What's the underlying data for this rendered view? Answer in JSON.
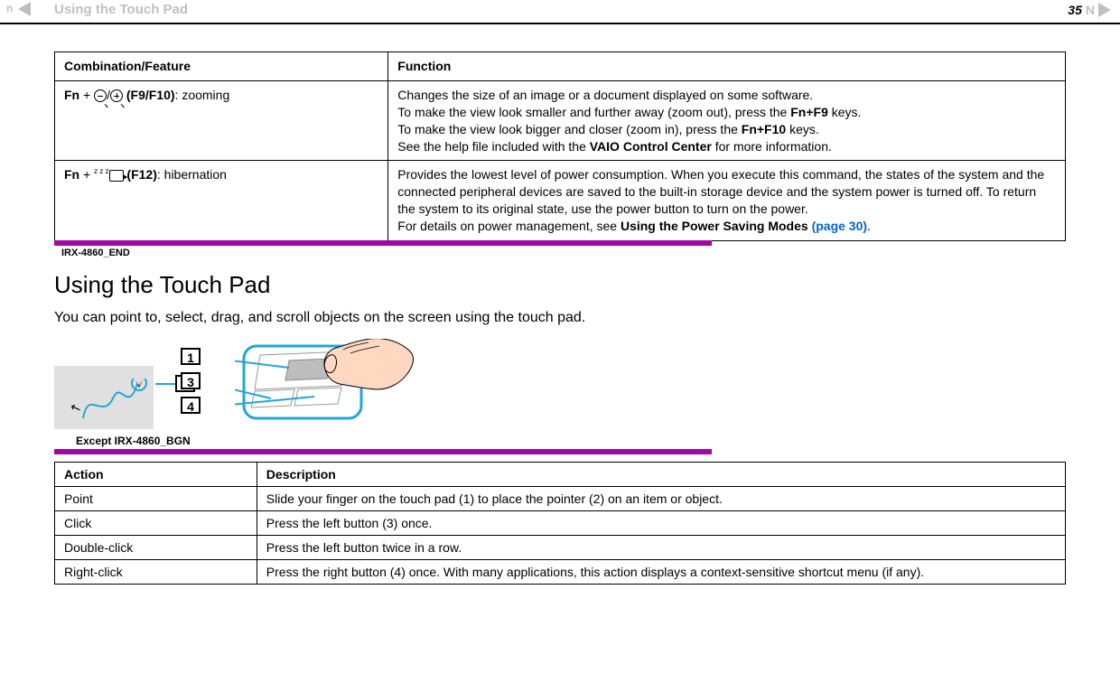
{
  "header": {
    "nav_letter": "n",
    "breadcrumb": "Using the Touch Pad",
    "page_number": "35",
    "nav_letter_right": "N"
  },
  "fn_table": {
    "headers": {
      "combo": "Combination/Feature",
      "func": "Function"
    },
    "rows": [
      {
        "fn_prefix": "Fn",
        "plus": " + ",
        "keys": "(F9/F10)",
        "label": ": zooming",
        "func_l1": "Changes the size of an image or a document displayed on some software.",
        "func_l2_a": "To make the view look smaller and further away (zoom out), press the ",
        "func_l2_b": "Fn+F9",
        "func_l2_c": " keys.",
        "func_l3_a": "To make the view look bigger and closer (zoom in), press the ",
        "func_l3_b": "Fn+F10",
        "func_l3_c": " keys.",
        "func_l4_a": "See the help file included with the ",
        "func_l4_b": "VAIO Control Center",
        "func_l4_c": " for more information."
      },
      {
        "fn_prefix": "Fn",
        "plus": " + ",
        "keys": "(F12)",
        "label": ": hibernation",
        "z": "z z z",
        "func_p1": "Provides the lowest level of power consumption. When you execute this command, the states of the system and the connected peripheral devices are saved to the built-in storage device and the system power is turned off. To return the system to its original state, use the power button to turn on the power.",
        "func_p2_a": "For details on power management, see ",
        "func_p2_b": "Using the Power Saving Modes ",
        "func_p2_link": "(page 30)",
        "func_p2_c": "."
      }
    ]
  },
  "irx_end": "IRX-4860_END",
  "heading": "Using the Touch Pad",
  "intro": "You can point to, select, drag, and scroll objects on the screen using the touch pad.",
  "diagram": {
    "labels": {
      "n1": "1",
      "n2": "2",
      "n3": "3",
      "n4": "4"
    }
  },
  "except_label": "Except IRX-4860_BGN",
  "action_table": {
    "headers": {
      "action": "Action",
      "desc": "Description"
    },
    "rows": [
      {
        "action": "Point",
        "desc": "Slide your finger on the touch pad (1) to place the pointer (2) on an item or object."
      },
      {
        "action": "Click",
        "desc": "Press the left button (3) once."
      },
      {
        "action": "Double-click",
        "desc": "Press the left button twice in a row."
      },
      {
        "action": "Right-click",
        "desc": "Press the right button (4) once. With many applications, this action displays a context-sensitive shortcut menu (if any)."
      }
    ]
  }
}
